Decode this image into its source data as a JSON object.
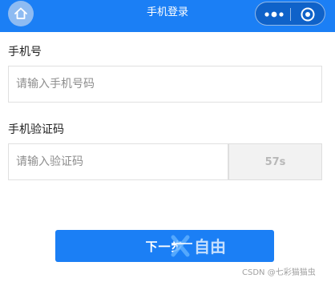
{
  "header": {
    "title": "手机登录",
    "home_icon": "home-icon",
    "more_icon": "more-dots-icon",
    "close_icon": "capsule-close-icon"
  },
  "form": {
    "phone_label": "手机号",
    "phone_placeholder": "请输入手机号码",
    "code_label": "手机验证码",
    "code_placeholder": "请输入验证码",
    "countdown": "57s"
  },
  "actions": {
    "next_label": "下一步"
  },
  "watermark": {
    "logo_text": "自由",
    "text": "CSDN @七彩猫猫虫"
  },
  "colors": {
    "accent": "#1b7ff5",
    "capsule": "#0f62c9",
    "disabled_bg": "#f2f2f2",
    "disabled_text": "#b8b8b8"
  }
}
